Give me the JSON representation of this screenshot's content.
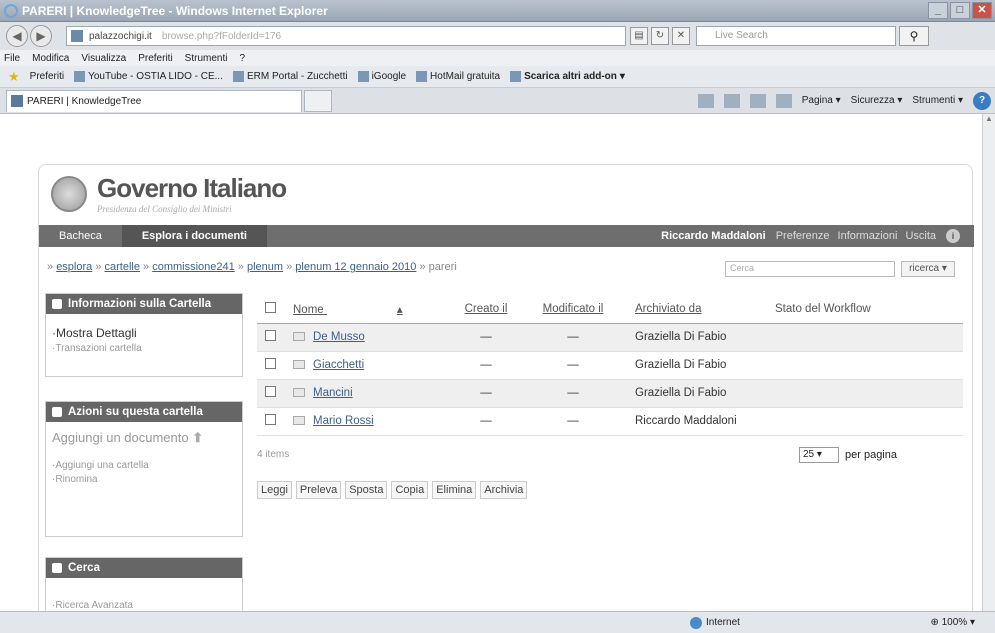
{
  "window": {
    "title": "PARERI | KnowledgeTree - Windows Internet Explorer"
  },
  "address": {
    "domain": "palazzochigi.it",
    "rest": "browse.php?fFolderId=176"
  },
  "search": {
    "placeholder": "Live Search"
  },
  "menu": [
    "File",
    "Modifica",
    "Visualizza",
    "Preferiti",
    "Strumenti",
    "?"
  ],
  "favorites": {
    "label": "Preferiti",
    "items": [
      "YouTube - OSTIA LIDO - CE...",
      "ERM Portal - Zucchetti",
      "iGoogle",
      "HotMail gratuita",
      "Scarica altri add-on"
    ]
  },
  "tab": {
    "title": "PARERI | KnowledgeTree"
  },
  "commands": {
    "page": "Pagina",
    "security": "Sicurezza",
    "tools": "Strumenti"
  },
  "site": {
    "logo_main": "Governo Italiano",
    "logo_sub": "Presidenza del Consiglio dei Ministri"
  },
  "nav": {
    "dashboard": "Bacheca",
    "browse": "Esplora i documenti",
    "user": "Riccardo Maddaloni",
    "prefs": "Preferenze",
    "info": "Informazioni",
    "logout": "Uscita"
  },
  "breadcrumb": {
    "prefix": "»",
    "items": [
      "esplora",
      "cartelle",
      "commissione241",
      "plenum",
      "plenum 12 gennaio 2010"
    ],
    "current": "pareri",
    "search_placeholder": "Cerca",
    "search_button": "ricerca"
  },
  "sidebar": {
    "folder_info": {
      "title": "Informazioni sulla Cartella",
      "items": [
        "Mostra Dettagli",
        "Transazioni cartella"
      ]
    },
    "folder_actions": {
      "title": "Azioni su questa cartella",
      "add_document": "Aggiungi un documento",
      "items": [
        "Aggiungi una cartella",
        "Rinomina"
      ]
    },
    "search": {
      "title": "Cerca",
      "items": [
        "Ricerca Avanzata"
      ]
    }
  },
  "table": {
    "headers": [
      "Nome",
      "Creato il",
      "Modificato il",
      "Archiviato da",
      "Stato del Workflow"
    ],
    "rows": [
      {
        "name": "De Musso",
        "created": "—",
        "modified": "—",
        "by": "Graziella Di Fabio",
        "state": ""
      },
      {
        "name": "Giacchetti",
        "created": "—",
        "modified": "—",
        "by": "Graziella Di Fabio",
        "state": ""
      },
      {
        "name": "Mancini",
        "created": "—",
        "modified": "—",
        "by": "Graziella Di Fabio",
        "state": ""
      },
      {
        "name": "Mario Rossi",
        "created": "—",
        "modified": "—",
        "by": "Riccardo Maddaloni",
        "state": ""
      }
    ],
    "count": "4 items",
    "per_page_value": "25",
    "per_page_label": "per pagina"
  },
  "actions": [
    "Leggi",
    "Preleva",
    "Sposta",
    "Copia",
    "Elimina",
    "Archivia"
  ],
  "status": {
    "zone": "Internet",
    "zoom": "100%"
  }
}
